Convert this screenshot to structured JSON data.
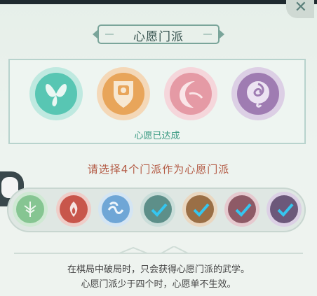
{
  "dialog": {
    "title": "心愿门派",
    "wish_status": "心愿已达成",
    "instruction": "请选择4个门派作为心愿门派",
    "hint_line1": "在棋局中破局时，只会获得心愿门派的武学。",
    "hint_line2": "心愿门派少于四个时，心愿单不生效。"
  },
  "icons": {
    "close": "close-icon",
    "butterfly": "butterfly-icon",
    "shield": "shield-icon",
    "crescent": "crescent-icon",
    "rose": "rose-icon",
    "feather": "feather-icon",
    "flame": "flame-icon",
    "wave": "wave-icon",
    "check": "check-icon"
  },
  "colors": {
    "teal": "#52c3b1",
    "orange": "#e7a457",
    "pink": "#e39aa3",
    "purple": "#a07bb2",
    "green": "#83c28d",
    "red": "#c7544a",
    "blue": "#6fa5d5",
    "accent_check": "#35c6f0"
  }
}
